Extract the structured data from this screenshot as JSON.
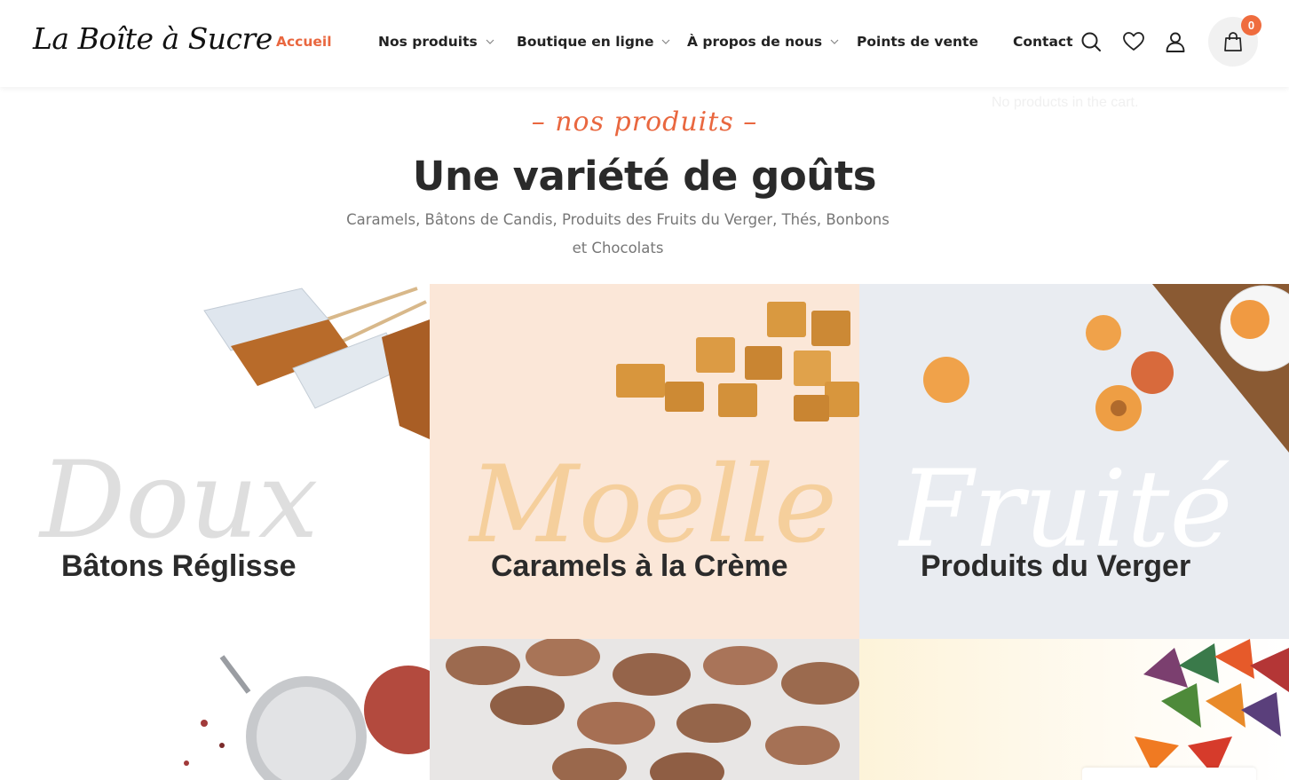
{
  "header": {
    "logo": "La Boîte à Sucre",
    "nav": [
      {
        "label": "Accueil",
        "active": true,
        "dropdown": false
      },
      {
        "label": "Nos produits",
        "active": false,
        "dropdown": true
      },
      {
        "label": "Boutique en ligne",
        "active": false,
        "dropdown": true
      },
      {
        "label": "À propos de nous",
        "active": false,
        "dropdown": true
      },
      {
        "label": "Points de vente",
        "active": false,
        "dropdown": false
      },
      {
        "label": "Contact",
        "active": false,
        "dropdown": false
      }
    ],
    "icons": [
      "search-icon",
      "heart-icon",
      "user-icon",
      "bag-icon"
    ],
    "cart_count": "0",
    "cart_empty_text": "No products in the cart."
  },
  "section": {
    "eyebrow": "– nos produits –",
    "title": "Une variété de goûts",
    "subtitle": "Caramels, Bâtons de Candis, Produits des Fruits du Verger, Thés, Bonbons et Chocolats"
  },
  "tiles": [
    {
      "label": "Bâtons Réglisse",
      "script": "Doux",
      "bg": "#ffffff",
      "script_color": "#dedede"
    },
    {
      "label": "Caramels à la Crème",
      "script": "Moelle",
      "bg": "#fbe7d8",
      "script_color": "#f5cf9c"
    },
    {
      "label": "Produits du Verger",
      "script": "Fruité",
      "bg": "#e9ecf1",
      "script_color": "#ffffff"
    },
    {
      "label": "",
      "script": "",
      "bg": "#ffffff"
    },
    {
      "label": "",
      "script": "",
      "bg": "#e8e6e5"
    },
    {
      "label": "",
      "script": "",
      "bg": "#fdf3d9"
    }
  ],
  "colors": {
    "accent": "#e9673f",
    "badge": "#ef6c3e"
  }
}
